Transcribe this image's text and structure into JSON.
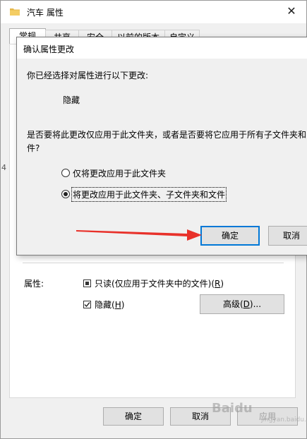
{
  "window": {
    "title": "汽车 属性",
    "close_glyph": "✕",
    "tabs": [
      "常规",
      "共享",
      "安全",
      "以前的版本",
      "自定义"
    ],
    "attributes_label": "属性:",
    "readonly": {
      "label_prefix": "只读(仅应用于文件夹中的文件)(",
      "accel": "R",
      "label_suffix": ")"
    },
    "hidden": {
      "label_prefix": "隐藏(",
      "accel": "H",
      "label_suffix": ")"
    },
    "advanced_button": {
      "prefix": "高级(",
      "accel": "D",
      "suffix": ")..."
    },
    "ok_button": "确定",
    "cancel_button": "取消",
    "apply_button": "应用"
  },
  "dialog": {
    "title": "确认属性更改",
    "prompt": "你已经选择对属性进行以下更改:",
    "change": "隐藏",
    "question_line1": "是否要将此更改仅应用于此文件夹，或者是否要将它应用于所有子文件夹和",
    "question_line2": "件?",
    "options": [
      {
        "label": "仅将更改应用于此文件夹",
        "selected": false
      },
      {
        "label": "将更改应用于此文件夹、子文件夹和文件",
        "selected": true
      }
    ],
    "ok_button": "确定",
    "cancel_button": "取消"
  },
  "stray_text": "4",
  "watermark": {
    "main": "Baidu",
    "sub": "jingyan.baidu.com"
  },
  "colors": {
    "focus_blue": "#0078d7",
    "arrow_red": "#e8312a"
  }
}
